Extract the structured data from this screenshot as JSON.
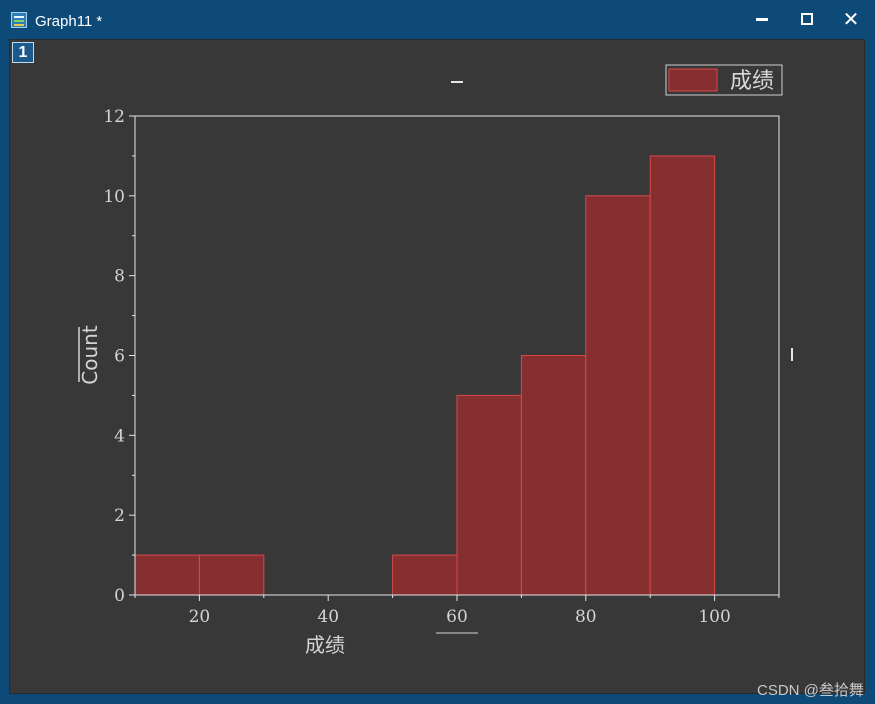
{
  "window": {
    "title": "Graph11 *",
    "layer_number": "1",
    "watermark": "CSDN @叁拾舞"
  },
  "colors": {
    "bar_fill": "#852f31",
    "bar_edge": "#d9474a",
    "background": "#383838",
    "axis": "#e6e6e6",
    "titlebar": "#0d4a78"
  },
  "chart_data": {
    "type": "bar",
    "histogram": true,
    "x_label": "成绩",
    "y_label": "Count",
    "legend": "成绩",
    "legend_position": "top-right",
    "xlim": [
      10,
      110
    ],
    "ylim": [
      0,
      12
    ],
    "x_ticks": [
      20,
      40,
      60,
      80,
      100
    ],
    "y_ticks": [
      0,
      2,
      4,
      6,
      8,
      10,
      12
    ],
    "grid": false,
    "bins": [
      {
        "start": 10,
        "end": 20,
        "count": 1
      },
      {
        "start": 20,
        "end": 30,
        "count": 1
      },
      {
        "start": 30,
        "end": 40,
        "count": 0
      },
      {
        "start": 40,
        "end": 50,
        "count": 0
      },
      {
        "start": 50,
        "end": 60,
        "count": 1
      },
      {
        "start": 60,
        "end": 70,
        "count": 5
      },
      {
        "start": 70,
        "end": 80,
        "count": 6
      },
      {
        "start": 80,
        "end": 90,
        "count": 10
      },
      {
        "start": 90,
        "end": 100,
        "count": 11
      }
    ]
  }
}
